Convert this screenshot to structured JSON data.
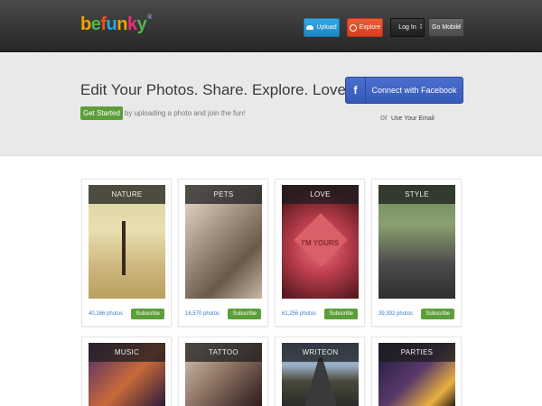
{
  "header": {
    "logo": {
      "letters": [
        "b",
        "e",
        "f",
        "u",
        "n",
        "k",
        "y"
      ],
      "colors": [
        "#f4a300",
        "#4cb748",
        "#f04e23",
        "#29a8e0",
        "#f4a300",
        "#ee2a7b",
        "#4cb748"
      ],
      "reg": "®"
    },
    "upload_label": "Upload",
    "explore_label": "Explore",
    "login_label": "Log In",
    "mobile_label": "Go Mobile"
  },
  "hero": {
    "title": "Edit Your Photos. Share. Explore. Love.",
    "get_started": "Get Started",
    "sub_text": "by uploading a photo and join the fun!",
    "facebook_label": "Connect with Facebook",
    "or_text": "or",
    "email_label": "Use Your Email"
  },
  "categories": [
    {
      "name": "NATURE",
      "count": "40,166 photos",
      "subscribe": "Subscribe"
    },
    {
      "name": "PETS",
      "count": "16,570 photos",
      "subscribe": "Subscribe"
    },
    {
      "name": "LOVE",
      "count": "61,256 photos",
      "subscribe": "Subscribe",
      "thumb_text": "I'M YOURS"
    },
    {
      "name": "STYLE",
      "count": "39,392 photos",
      "subscribe": "Subscribe"
    },
    {
      "name": "MUSIC"
    },
    {
      "name": "TATTOO"
    },
    {
      "name": "WRITEON"
    },
    {
      "name": "PARTIES"
    }
  ],
  "colors": {
    "accent_green": "#5c9e3a",
    "facebook_blue": "#3b5fc0",
    "upload_blue": "#2a9ad8",
    "explore_orange": "#e54d28"
  }
}
